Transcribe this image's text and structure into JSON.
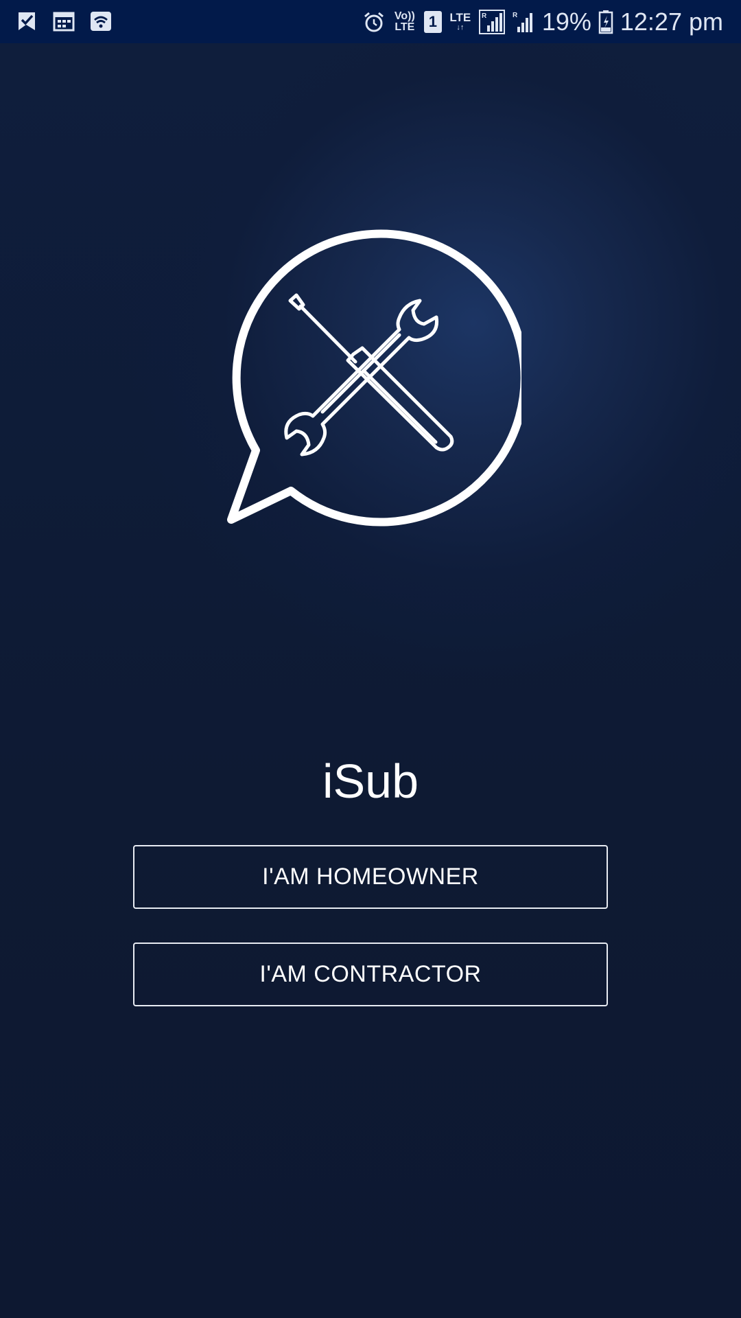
{
  "status_bar": {
    "left_icons": [
      "checkmark-flag-icon",
      "calendar-icon",
      "wifi-icon"
    ],
    "alarm_icon": "alarm-icon",
    "volte_top": "Vo))",
    "volte_bottom": "LTE",
    "sim_number": "1",
    "lte_label": "LTE",
    "battery_percent": "19%",
    "time": "12:27 pm"
  },
  "logo": {
    "icon": "chat-bubble-tools-icon"
  },
  "app": {
    "title": "iSub"
  },
  "buttons": {
    "homeowner_label": "I'AM HOMEOWNER",
    "contractor_label": "I'AM CONTRACTOR"
  },
  "colors": {
    "background": "#0e1a33",
    "status_bar": "#021a4a",
    "text": "#ffffff"
  }
}
